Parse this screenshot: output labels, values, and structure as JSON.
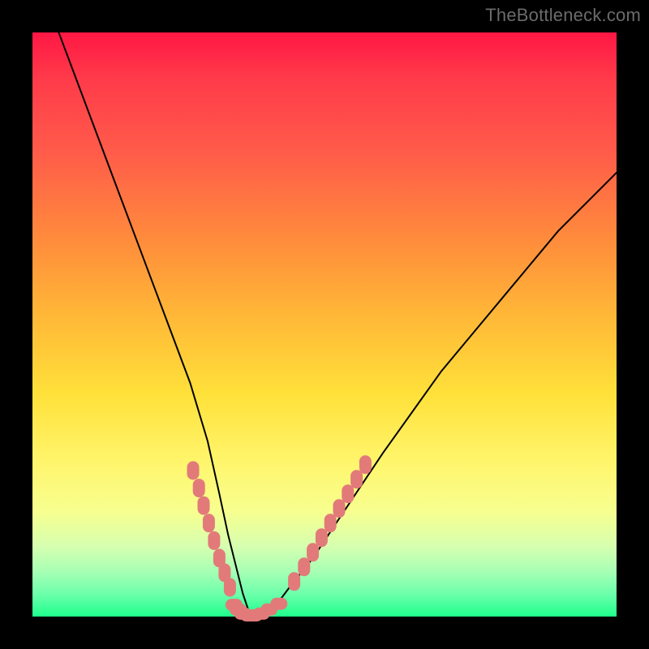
{
  "watermark": "TheBottleneck.com",
  "colors": {
    "frame_bg": "#000000",
    "gradient_top": "#ff1744",
    "gradient_bottom": "#1eff8d",
    "curve_stroke": "#000000",
    "marker_fill": "#e27a7a"
  },
  "chart_data": {
    "type": "line",
    "title": "",
    "xlabel": "",
    "ylabel": "",
    "xlim": [
      0,
      100
    ],
    "ylim": [
      0,
      100
    ],
    "grid": false,
    "legend": false,
    "series": [
      {
        "name": "bottleneck-curve",
        "x": [
          0,
          3,
          6,
          9,
          12,
          15,
          18,
          21,
          24,
          27,
          30,
          32,
          33.5,
          35,
          36,
          37,
          38.5,
          41,
          44,
          48,
          52,
          56,
          60,
          65,
          70,
          75,
          80,
          85,
          90,
          95,
          100
        ],
        "y": [
          112,
          104,
          96,
          88,
          80,
          72,
          64,
          56,
          48,
          40,
          30,
          21,
          14,
          8,
          4,
          1,
          0,
          1,
          5,
          10,
          16,
          22,
          28,
          35,
          42,
          48,
          54,
          60,
          66,
          71,
          76
        ]
      },
      {
        "name": "highlight-markers-left",
        "x": [
          27.5,
          28.5,
          29.3,
          30.2,
          31.1,
          32.0,
          32.9,
          33.8
        ],
        "y": [
          25.0,
          22.0,
          19.0,
          16.0,
          13.0,
          10.0,
          7.5,
          5.0
        ]
      },
      {
        "name": "highlight-markers-bottom",
        "x": [
          34.5,
          35.2,
          36.0,
          37.0,
          38.0,
          39.2,
          40.5,
          42.2
        ],
        "y": [
          2.0,
          1.2,
          0.5,
          0.2,
          0.2,
          0.5,
          1.2,
          2.2
        ]
      },
      {
        "name": "highlight-markers-right",
        "x": [
          44.8,
          46.5,
          48.0,
          49.5,
          51.0,
          52.5,
          54.0,
          55.5,
          57.0
        ],
        "y": [
          6.0,
          8.5,
          11.0,
          13.5,
          16.0,
          18.5,
          21.0,
          23.5,
          26.0
        ]
      }
    ],
    "annotations": []
  }
}
